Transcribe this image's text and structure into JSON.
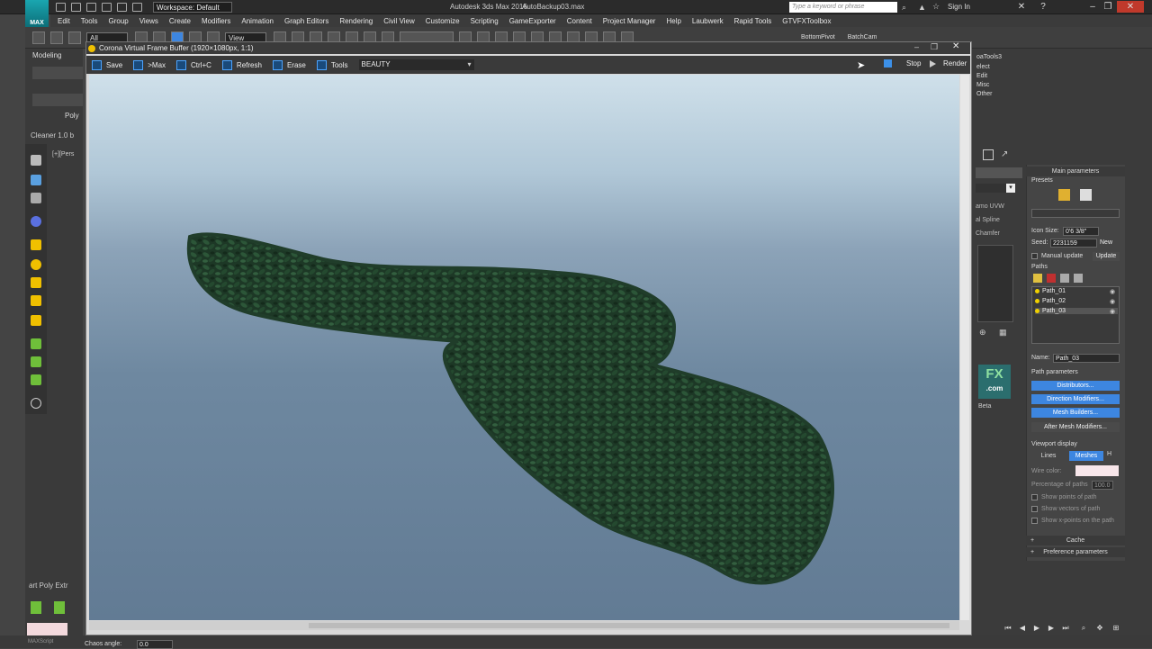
{
  "titlebar": {
    "workspace": "Workspace: Default",
    "app_name": "Autodesk 3ds Max 2016",
    "file_name": "AutoBackup03.max",
    "search_placeholder": "Type a keyword or phrase",
    "sign_in": "Sign In"
  },
  "menubar": [
    "Edit",
    "Tools",
    "Group",
    "Views",
    "Create",
    "Modifiers",
    "Animation",
    "Graph Editors",
    "Rendering",
    "Civil View",
    "Customize",
    "Scripting",
    "GameExporter",
    "Content",
    "Project Manager",
    "Help",
    "Laubwerk",
    "Rapid Tools",
    "GTVFXToolbox"
  ],
  "toolbar": {
    "selection_filter": "All",
    "reference_coord": "View",
    "right_items": [
      "BottomPivot",
      "BatchCam"
    ]
  },
  "left_panel": {
    "ribbon_tab": "Modeling",
    "poly_label": "Poly",
    "cleaner_label": "Cleaner 1.0 b",
    "viewport_label": "[+][Pers",
    "poly_extrude": "art Poly Extr"
  },
  "vfb": {
    "title": "Corona Virtual Frame Buffer (1920×1080px, 1:1)",
    "buttons": [
      "Save",
      ">Max",
      "Ctrl+C",
      "Refresh",
      "Erase",
      "Tools"
    ],
    "channel": "BEAUTY",
    "stop": "Stop",
    "render": "Render"
  },
  "right_panel": {
    "strip_items": [
      "oaTools3",
      "elect",
      "Edit",
      "Misc",
      "Other"
    ],
    "side_labels": [
      "amo UVW",
      "al Spline",
      "Chamfer"
    ],
    "beta_label": "Beta",
    "fx_logo": "FX",
    "fx_sub": ".com",
    "main_parameters": "Main parameters",
    "presets": "Presets",
    "icon_size_label": "Icon Size:",
    "icon_size_value": "0'6 3/8\"",
    "seed_label": "Seed:",
    "seed_value": "2231159",
    "new_button": "New",
    "manual_update": "Manual update",
    "update_button": "Update",
    "paths_label": "Paths",
    "paths": [
      "Path_01",
      "Path_02",
      "Path_03"
    ],
    "name_label": "Name:",
    "name_value": "Path_03",
    "path_parameters": "Path parameters",
    "distributors": "Distributors...",
    "direction_modifiers": "Direction Modifiers...",
    "mesh_builders": "Mesh Builders...",
    "after_mesh_modifiers": "After Mesh Modifiers...",
    "viewport_display": "Viewport display",
    "lines": "Lines",
    "meshes": "Meshes",
    "h_tab": "H",
    "wire_color": "Wire color:",
    "percentage_label": "Percentage of paths",
    "percentage_value": "100.0",
    "show_points": "Show points of path",
    "show_vectors": "Show vectors of path",
    "show_xpoints": "Show x-points on the path",
    "cache": "Cache",
    "preference_parameters": "Preference parameters"
  },
  "status": {
    "chaos_label": "Chaos angle:",
    "chaos_value": "0.0",
    "maxscript": "MAXScript"
  },
  "colors": {
    "accent_blue": "#3d86e0",
    "title_bar": "#2b2b2b",
    "panel": "#3b3b3b",
    "hedge_dark": "#1e3a2a"
  }
}
